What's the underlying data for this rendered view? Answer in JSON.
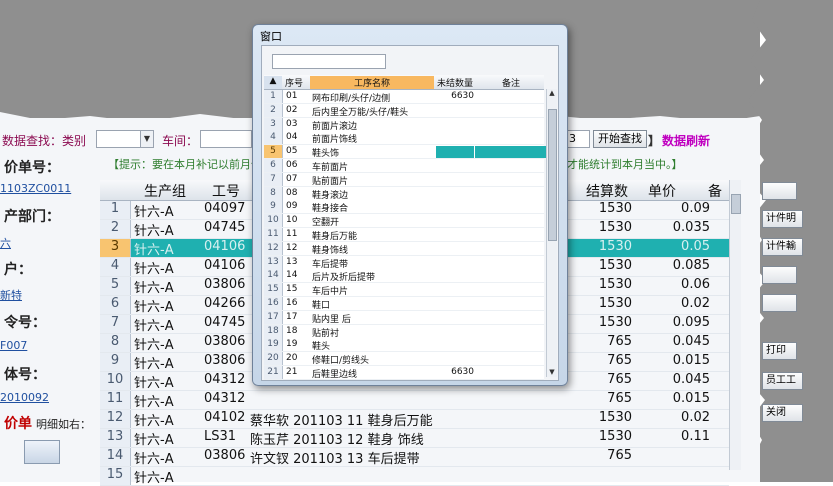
{
  "dialog": {
    "title": "窗口",
    "search_value": "",
    "columns": [
      "序号",
      "工序名称",
      "未结数量",
      "备注"
    ],
    "rows": [
      {
        "no": "01",
        "name": "网布印刷/头仔/边侧",
        "qty": "6630",
        "note": ""
      },
      {
        "no": "02",
        "name": "后内里全万能/头仔/鞋头",
        "qty": "",
        "note": ""
      },
      {
        "no": "03",
        "name": "前面片滚边",
        "qty": "",
        "note": ""
      },
      {
        "no": "04",
        "name": "前面片饰线",
        "qty": "",
        "note": ""
      },
      {
        "no": "05",
        "name": "鞋头饰",
        "qty": "",
        "note": ""
      },
      {
        "no": "06",
        "name": "车前面片",
        "qty": "",
        "note": ""
      },
      {
        "no": "07",
        "name": "贴前面片",
        "qty": "",
        "note": ""
      },
      {
        "no": "08",
        "name": "鞋身滚边",
        "qty": "",
        "note": ""
      },
      {
        "no": "09",
        "name": "鞋身接合",
        "qty": "",
        "note": ""
      },
      {
        "no": "10",
        "name": "空翻开",
        "qty": "",
        "note": ""
      },
      {
        "no": "11",
        "name": "鞋身后万能",
        "qty": "",
        "note": ""
      },
      {
        "no": "12",
        "name": "鞋身饰线",
        "qty": "",
        "note": ""
      },
      {
        "no": "13",
        "name": "车后提带",
        "qty": "",
        "note": ""
      },
      {
        "no": "14",
        "name": "后片及折后提带",
        "qty": "",
        "note": ""
      },
      {
        "no": "15",
        "name": "车后中片",
        "qty": "",
        "note": ""
      },
      {
        "no": "16",
        "name": "鞋口",
        "qty": "",
        "note": ""
      },
      {
        "no": "17",
        "name": "贴内里 后",
        "qty": "",
        "note": ""
      },
      {
        "no": "18",
        "name": "贴前衬",
        "qty": "",
        "note": ""
      },
      {
        "no": "19",
        "name": "鞋头",
        "qty": "",
        "note": ""
      },
      {
        "no": "20",
        "name": "修鞋口/剪线头",
        "qty": "",
        "note": ""
      },
      {
        "no": "21",
        "name": "后鞋里边线",
        "qty": "6630",
        "note": ""
      }
    ],
    "row_numbers": [
      "1",
      "2",
      "3",
      "4",
      "5",
      "6",
      "7",
      "8",
      "9",
      "10",
      "11",
      "12",
      "13",
      "14",
      "15",
      "16",
      "17",
      "18",
      "19",
      "20",
      "21"
    ],
    "selected_row": 5
  },
  "query": {
    "label_left": "数据查找：类别",
    "label_workshop": "车间：",
    "combo_right_value": "3",
    "search_button": "开始查找",
    "bracket": "】",
    "refresh": "数据刷新"
  },
  "tips": {
    "left": "【提示：要在本月补记以前月份",
    "right": "作才能统计到本月当中。】"
  },
  "side": {
    "price_no_label": "价单号：",
    "price_no_value": "1103ZC0011",
    "dept_label": "产部门：",
    "dept_value": "六",
    "client_label": "户：",
    "client_value": "新特",
    "order_label": "令号：",
    "order_value": "F007",
    "body_label": "体号：",
    "body_value": "2010092",
    "price_label": "价单",
    "detail_label": "明细如右："
  },
  "grid": {
    "headers": [
      "生产组",
      "工号",
      "结算数",
      "单价",
      "备"
    ],
    "rows": [
      {
        "n": "1",
        "group": "针六-A",
        "id": "04097",
        "mid": "",
        "amount": "1530",
        "price": "0.09"
      },
      {
        "n": "2",
        "group": "针六-A",
        "id": "04745",
        "mid": "",
        "amount": "1530",
        "price": "0.035"
      },
      {
        "n": "3",
        "group": "针六-A",
        "id": "04106",
        "mid": "",
        "amount": "1530",
        "price": "0.05"
      },
      {
        "n": "4",
        "group": "针六-A",
        "id": "04106",
        "mid": "",
        "amount": "1530",
        "price": "0.085"
      },
      {
        "n": "5",
        "group": "针六-A",
        "id": "03806",
        "mid": "",
        "amount": "1530",
        "price": "0.06"
      },
      {
        "n": "6",
        "group": "针六-A",
        "id": "04266",
        "mid": "",
        "amount": "1530",
        "price": "0.02"
      },
      {
        "n": "7",
        "group": "针六-A",
        "id": "04745",
        "mid": "",
        "amount": "1530",
        "price": "0.095"
      },
      {
        "n": "8",
        "group": "针六-A",
        "id": "03806",
        "mid": "",
        "amount": "765",
        "price": "0.045"
      },
      {
        "n": "9",
        "group": "针六-A",
        "id": "03806",
        "mid": "",
        "amount": "765",
        "price": "0.015"
      },
      {
        "n": "10",
        "group": "针六-A",
        "id": "04312",
        "mid": "",
        "amount": "765",
        "price": "0.045"
      },
      {
        "n": "11",
        "group": "针六-A",
        "id": "04312",
        "mid": "",
        "amount": "765",
        "price": "0.015"
      },
      {
        "n": "12",
        "group": "针六-A",
        "id": "04102",
        "mid": "蔡华软   201103   11      鞋身后万能",
        "amount": "1530",
        "price": "0.02"
      },
      {
        "n": "13",
        "group": "针六-A",
        "id": "LS31",
        "mid": "陈玉芹   201103   12      鞋身 饰线",
        "amount": "1530",
        "price": "0.11"
      },
      {
        "n": "14",
        "group": "针六-A",
        "id": "03806",
        "mid": "许文钗   201103   13      车后提带",
        "amount": "765",
        "price": ""
      },
      {
        "n": "15",
        "group": "针六-A",
        "id": "",
        "mid": "",
        "amount": "",
        "price": ""
      }
    ],
    "selected_row": 3
  },
  "right_buttons": [
    "计件明",
    "计件輸",
    "打印",
    "员工工",
    "关闭"
  ]
}
